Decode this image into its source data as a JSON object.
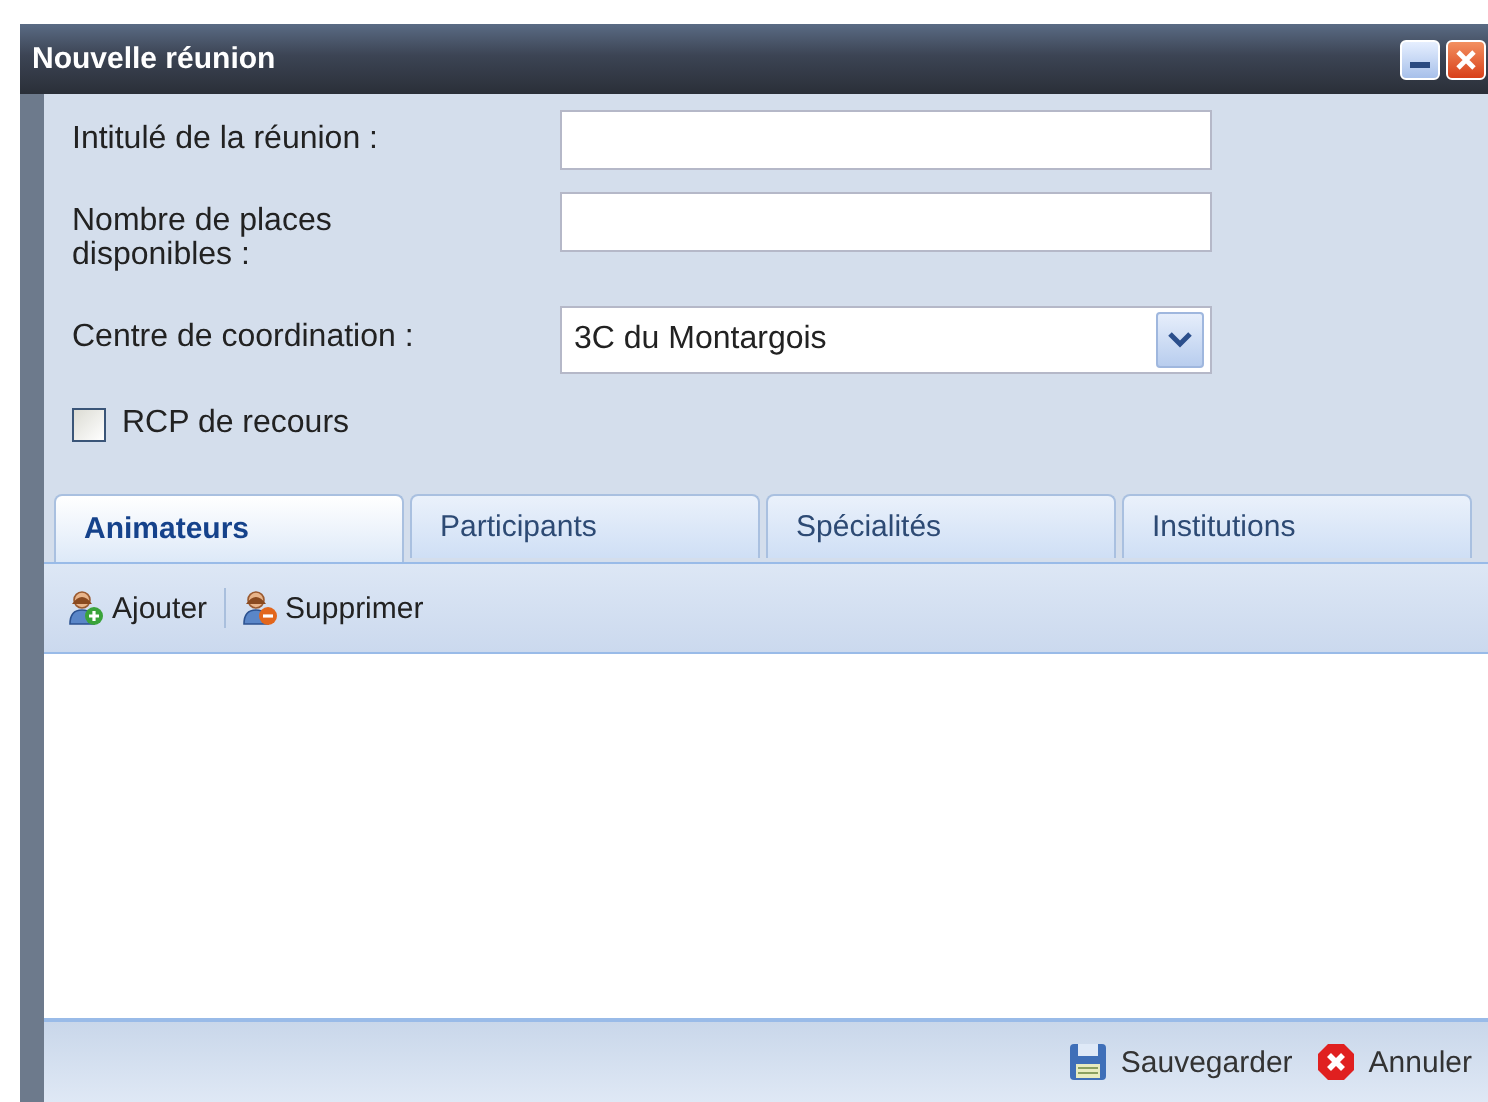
{
  "window": {
    "title": "Nouvelle réunion"
  },
  "form": {
    "title_label": "Intitulé de la réunion :",
    "places_label": "Nombre de places disponibles :",
    "centre_label": "Centre de coordination :",
    "centre_value": "3C du Montargois",
    "recours": {
      "label": "RCP de recours",
      "checked": false
    }
  },
  "tabs": [
    {
      "label": "Animateurs",
      "selected": true
    },
    {
      "label": "Participants",
      "selected": false
    },
    {
      "label": "Spécialités",
      "selected": false
    },
    {
      "label": "Institutions",
      "selected": false
    }
  ],
  "toolbar": [
    {
      "label": "Ajouter",
      "kind": "add"
    },
    {
      "label": "Supprimer",
      "kind": "remove"
    }
  ],
  "footer": [
    {
      "label": "Sauvegarder",
      "kind": "save"
    },
    {
      "label": "Annuler",
      "kind": "cancel"
    }
  ]
}
